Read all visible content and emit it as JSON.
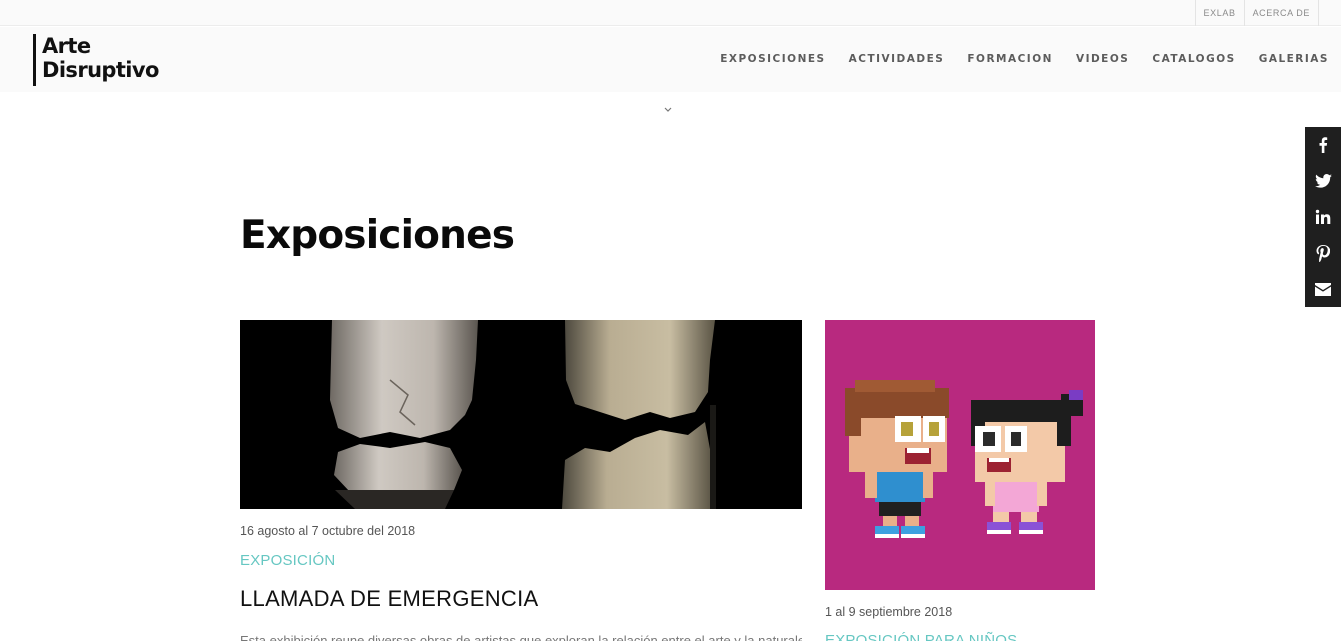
{
  "topbar": {
    "links": [
      "EXLAB",
      "ACERCA DE"
    ]
  },
  "logo": {
    "line1": "Arte",
    "line2": "Disruptivo"
  },
  "nav": {
    "items": [
      "EXPOSICIONES",
      "ACTIVIDADES",
      "FORMACION",
      "VIDEOS",
      "CATALOGOS",
      "GALERIAS"
    ]
  },
  "social": {
    "icons": [
      "facebook-icon",
      "twitter-icon",
      "linkedin-icon",
      "pinterest-icon",
      "email-icon"
    ]
  },
  "page": {
    "title": "Exposiciones"
  },
  "posts": [
    {
      "date": "16 agosto al 7 octubre del 2018",
      "category": "EXPOSICIÓN",
      "title": "LLAMADA DE EMERGENCIA",
      "excerpt": "Esta exhibición reune diversas obras de artistas que exploran la relación entre el arte y la naturaleza a través de distintas"
    },
    {
      "date": "1 al 9 septiembre 2018",
      "category": "EXPOSICIÓN PARA NIÑOS"
    }
  ],
  "colors": {
    "accent": "#66c7c2",
    "card2_bg": "#b8297f",
    "social_bg": "#1f1f1f"
  }
}
